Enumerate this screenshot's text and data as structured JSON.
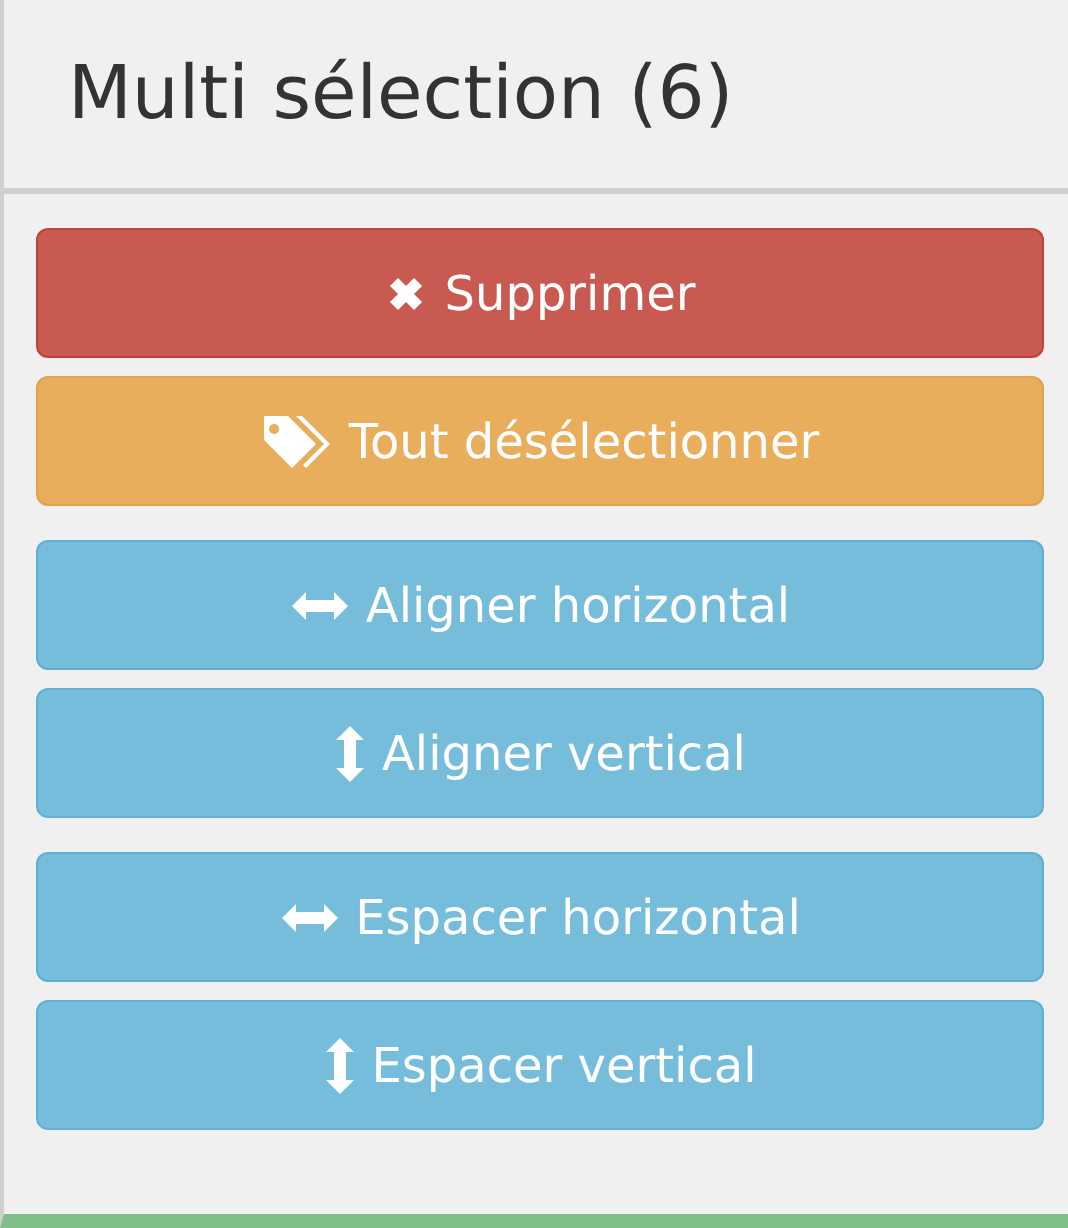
{
  "panel": {
    "title": "Multi sélection (6)",
    "button_groups": [
      [
        {
          "label": "Supprimer",
          "kind": "delete"
        },
        {
          "label": "Tout désélectionner",
          "kind": "deselect"
        }
      ],
      [
        {
          "label": "Aligner horizontal",
          "kind": "horizontal"
        },
        {
          "label": "Aligner vertical",
          "kind": "vertical"
        }
      ],
      [
        {
          "label": "Espacer horizontal",
          "kind": "horizontal"
        },
        {
          "label": "Espacer vertical",
          "kind": "vertical"
        }
      ]
    ]
  }
}
